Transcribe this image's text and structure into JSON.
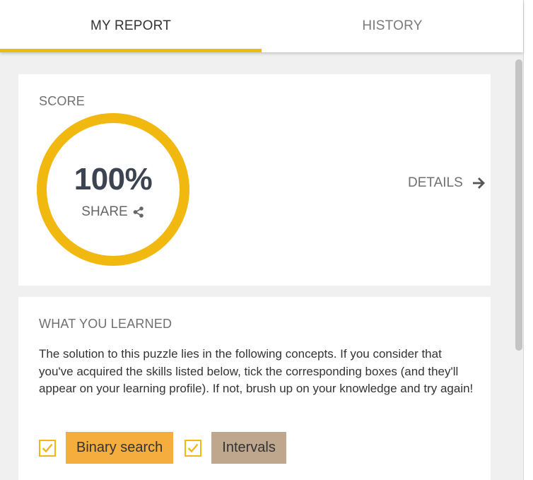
{
  "tabs": {
    "my_report": "MY REPORT",
    "history": "HISTORY",
    "active": "my_report"
  },
  "score_card": {
    "heading": "SCORE",
    "value": "100%",
    "progress_percent": 100,
    "share_label": "SHARE",
    "details_label": "DETAILS"
  },
  "learned_card": {
    "heading": "WHAT YOU LEARNED",
    "description": "The solution to this puzzle lies in the following concepts. If you consider that you've acquired the skills listed below, tick the corresponding boxes (and they'll appear on your learning profile). If not, brush up on your knowledge and try again!",
    "skills": [
      {
        "label": "Binary search",
        "checked": true
      },
      {
        "label": "Intervals",
        "checked": true
      }
    ]
  },
  "icons": {
    "share": "share-icon",
    "details": "arrow-right-icon",
    "check": "checkmark-icon"
  },
  "colors": {
    "accent": "#f1b80f",
    "score_text": "#3d4451",
    "binary_tag": "#f5ae3d",
    "intervals_tag": "#bfa78d",
    "background": "#f0f0f0"
  }
}
